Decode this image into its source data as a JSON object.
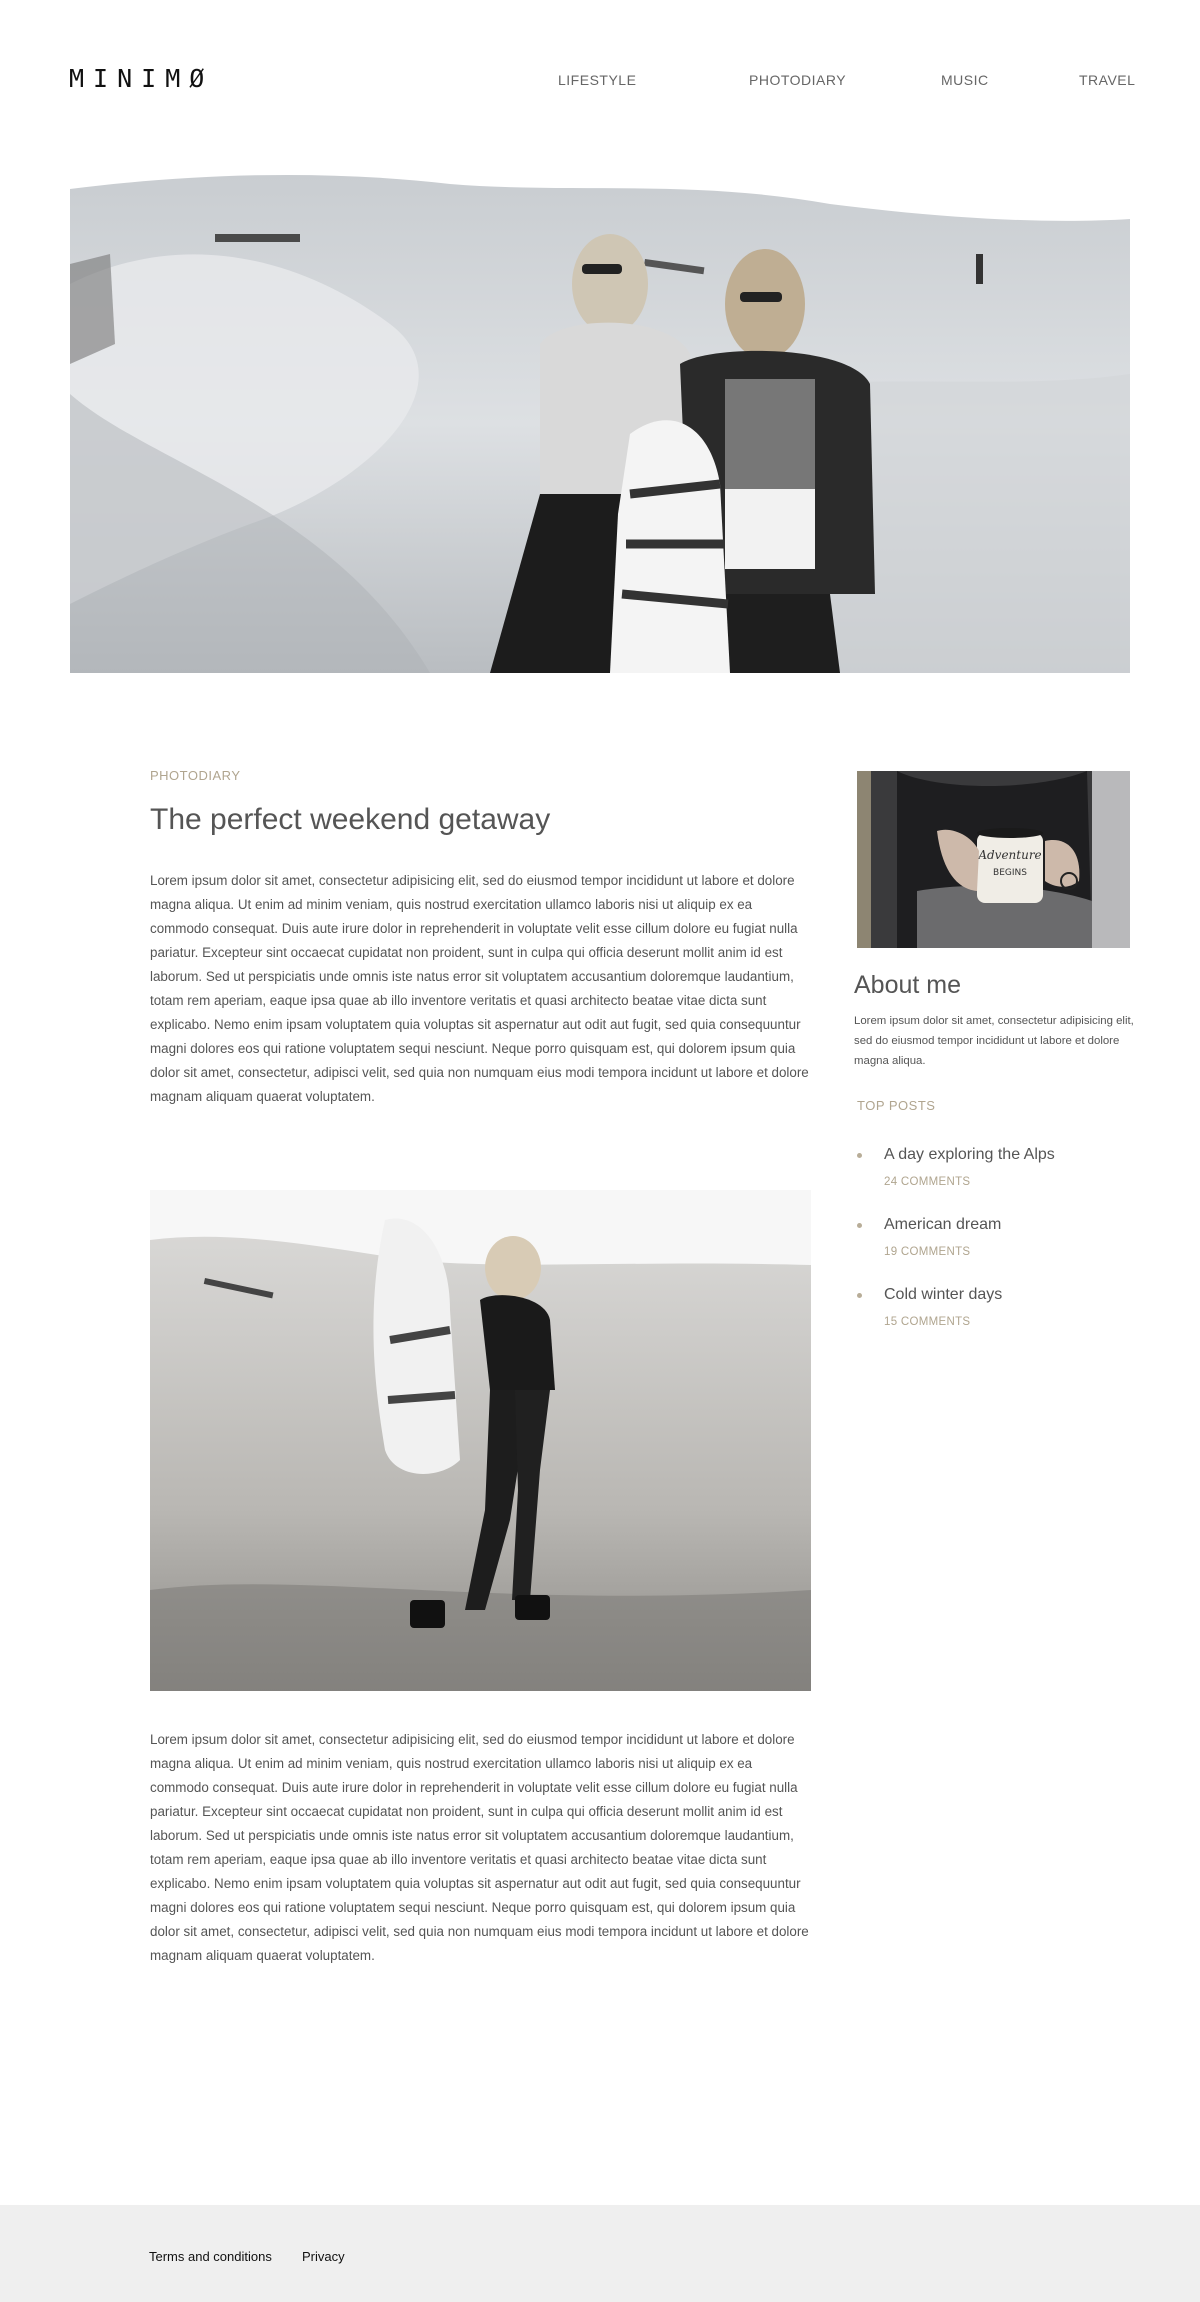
{
  "header": {
    "logo": "MINIMØ",
    "nav": [
      "LIFESTYLE",
      "PHOTODIARY",
      "MUSIC",
      "TRAVEL"
    ]
  },
  "article": {
    "category": "PHOTODIARY",
    "title": "The perfect weekend getaway",
    "paragraph1": "Lorem ipsum dolor sit amet, consectetur adipisicing elit, sed do eiusmod tempor incididunt ut labore et dolore magna aliqua. Ut enim ad minim veniam, quis nostrud exercitation ullamco laboris nisi ut aliquip ex ea commodo consequat. Duis aute irure dolor in reprehenderit in voluptate velit esse cillum dolore eu fugiat nulla pariatur. Excepteur sint occaecat cupidatat non proident, sunt in culpa qui officia deserunt mollit anim id est laborum. Sed ut perspiciatis unde omnis iste natus error sit voluptatem accusantium doloremque laudantium, totam rem aperiam, eaque ipsa quae ab illo inventore veritatis et quasi architecto beatae vitae dicta sunt explicabo. Nemo enim ipsam voluptatem quia voluptas sit aspernatur aut odit aut fugit, sed quia consequuntur magni dolores eos qui ratione voluptatem sequi nesciunt. Neque porro quisquam est, qui dolorem ipsum quia dolor sit amet, consectetur, adipisci velit, sed quia non numquam eius modi tempora incidunt ut labore et dolore magnam aliquam quaerat voluptatem.",
    "paragraph2": "Lorem ipsum dolor sit amet, consectetur adipisicing elit, sed do eiusmod tempor incididunt ut labore et dolore magna aliqua. Ut enim ad minim veniam, quis nostrud exercitation ullamco laboris nisi ut aliquip ex ea commodo consequat. Duis aute irure dolor in reprehenderit in voluptate velit esse cillum dolore eu fugiat nulla pariatur. Excepteur sint occaecat cupidatat non proident, sunt in culpa qui officia deserunt mollit anim id est laborum. Sed ut perspiciatis unde omnis iste natus error sit voluptatem accusantium doloremque laudantium, totam rem aperiam, eaque ipsa quae ab illo inventore veritatis et quasi architecto beatae vitae dicta sunt explicabo. Nemo enim ipsam voluptatem quia voluptas sit aspernatur aut odit aut fugit, sed quia consequuntur magni dolores eos qui ratione voluptatem sequi nesciunt. Neque porro quisquam est, qui dolorem ipsum quia dolor sit amet, consectetur, adipisci velit, sed quia non numquam eius modi tempora incidunt ut labore et dolore magnam aliquam quaerat voluptatem."
  },
  "sidebar": {
    "about_title": "About me",
    "about_text": "Lorem ipsum dolor sit amet, consectetur adipisicing elit, sed do eiusmod tempor incididunt ut labore et dolore magna aliqua.",
    "mug_text": [
      "Adventure",
      "BEGINS"
    ],
    "top_posts_label": "TOP POSTS",
    "posts": [
      {
        "title": "A day exploring the Alps",
        "comments": "24 COMMENTS"
      },
      {
        "title": "American dream",
        "comments": "19 COMMENTS"
      },
      {
        "title": "Cold winter days",
        "comments": "15 COMMENTS"
      }
    ]
  },
  "footer": {
    "links": [
      "Terms and conditions",
      "Privacy"
    ]
  }
}
